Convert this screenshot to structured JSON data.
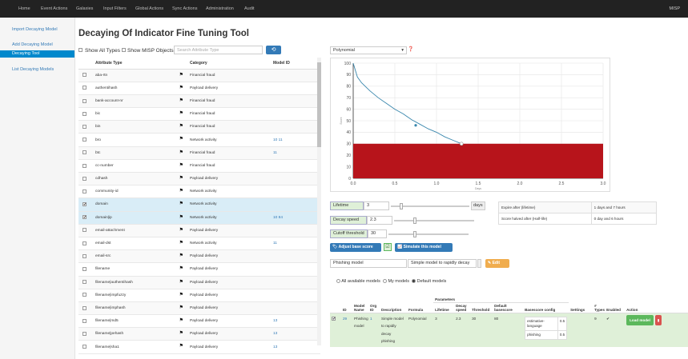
{
  "nav": {
    "items": [
      "Home",
      "Event Actions",
      "Galaxies",
      "Input Filters",
      "Global Actions",
      "Sync Actions",
      "Administration",
      "Audit"
    ],
    "brand": "MISP"
  },
  "sidebar": {
    "items": [
      {
        "label": "Import Decaying Model",
        "active": false
      },
      {
        "label": "Add Decaying Model",
        "active": false
      },
      {
        "label": "Decaying Tool",
        "active": true
      },
      {
        "label": "List Decaying Models",
        "active": false
      }
    ]
  },
  "page_title": "Decaying Of Indicator Fine Tuning Tool",
  "filters": {
    "show_all_types": "Show All Types",
    "show_misp_objects": "Show MISP Objects",
    "search_placeholder": "Search Attribute Type",
    "refresh_icon": "refresh-icon"
  },
  "attr_table": {
    "headers": [
      "",
      "Attribute Type",
      "Category",
      "Model ID"
    ],
    "rows": [
      {
        "type": "aba-rtn",
        "category": "Financial fraud",
        "model_id": "",
        "checked": false
      },
      {
        "type": "authentihash",
        "category": "Payload delivery",
        "model_id": "",
        "checked": false
      },
      {
        "type": "bank-account-nr",
        "category": "Financial fraud",
        "model_id": "",
        "checked": false
      },
      {
        "type": "bic",
        "category": "Financial fraud",
        "model_id": "",
        "checked": false
      },
      {
        "type": "bin",
        "category": "Financial fraud",
        "model_id": "",
        "checked": false
      },
      {
        "type": "bro",
        "category": "Network activity",
        "model_id": "10 11",
        "checked": false
      },
      {
        "type": "btc",
        "category": "Financial fraud",
        "model_id": "11",
        "checked": false
      },
      {
        "type": "cc-number",
        "category": "Financial fraud",
        "model_id": "",
        "checked": false
      },
      {
        "type": "cdhash",
        "category": "Payload delivery",
        "model_id": "",
        "checked": false
      },
      {
        "type": "community-id",
        "category": "Network activity",
        "model_id": "",
        "checked": false
      },
      {
        "type": "domain",
        "category": "Network activity",
        "model_id": "",
        "checked": true
      },
      {
        "type": "domain|ip",
        "category": "Network activity",
        "model_id": "10 84",
        "checked": true
      },
      {
        "type": "email-attachment",
        "category": "Payload delivery",
        "model_id": "",
        "checked": false
      },
      {
        "type": "email-dst",
        "category": "Network activity",
        "model_id": "11",
        "checked": false
      },
      {
        "type": "email-src",
        "category": "Payload delivery",
        "model_id": "",
        "checked": false
      },
      {
        "type": "filename",
        "category": "Payload delivery",
        "model_id": "",
        "checked": false
      },
      {
        "type": "filename|authentihash",
        "category": "Payload delivery",
        "model_id": "",
        "checked": false
      },
      {
        "type": "filename|impfuzzy",
        "category": "Payload delivery",
        "model_id": "",
        "checked": false
      },
      {
        "type": "filename|imphash",
        "category": "Payload delivery",
        "model_id": "",
        "checked": false
      },
      {
        "type": "filename|md5",
        "category": "Payload delivery",
        "model_id": "13",
        "checked": false
      },
      {
        "type": "filename|pehash",
        "category": "Payload delivery",
        "model_id": "13",
        "checked": false
      },
      {
        "type": "filename|sha1",
        "category": "Payload delivery",
        "model_id": "13",
        "checked": false
      }
    ]
  },
  "formula_select": {
    "value": "Polynomial",
    "help_icon": "question-circle-icon"
  },
  "chart_data": {
    "type": "line",
    "xlabel": "Days",
    "ylabel": "Score",
    "xlim": [
      0,
      3
    ],
    "ylim": [
      0,
      100
    ],
    "xticks": [
      "0.0",
      "0.5",
      "1.0",
      "1.5",
      "2.0",
      "2.5",
      "3.0"
    ],
    "yticks": [
      "0",
      "10",
      "20",
      "30",
      "40",
      "50",
      "60",
      "70",
      "80",
      "90",
      "100"
    ],
    "series": [
      {
        "x": [
          0,
          0.05,
          0.1,
          0.2,
          0.3,
          0.4,
          0.5,
          0.6,
          0.7,
          0.8,
          0.9,
          1.0,
          1.1,
          1.2,
          1.3
        ],
        "y": [
          100,
          88,
          83,
          76,
          70,
          65,
          60,
          56,
          51,
          47,
          43,
          40,
          36,
          33,
          30
        ]
      }
    ],
    "markers": [
      {
        "x": 0.75,
        "y": 46
      },
      {
        "x": 1.3,
        "y": 30
      }
    ],
    "threshold_band": {
      "from": 0,
      "to": 30,
      "color": "#b7141b"
    },
    "line_color": "#3a87ad",
    "grid": true
  },
  "controls": {
    "lifetime_label": "Lifetime",
    "lifetime_value": "3",
    "lifetime_unit": "days",
    "lifetime_slider": 0.1,
    "decay_label": "Decay speed",
    "decay_value": "2.3",
    "decay_slider": 0.23,
    "cutoff_label": "Cutoff threshold",
    "cutoff_value": "30",
    "cutoff_slider": 0.3,
    "adjust_btn": "Adjust base score",
    "simulate_btn": "Simulate this model"
  },
  "info": {
    "rows": [
      [
        "Expire after (lifetime)",
        "1 days and 7 hours"
      ],
      [
        "Score halved after (Half-life)",
        "0 day and 6 hours"
      ]
    ]
  },
  "model_form": {
    "name": "Phishing model",
    "description": "Simple model to rapidly decay",
    "edit_btn": "Edit"
  },
  "model_filter": {
    "all": "All available models",
    "mine": "My models",
    "default": "Default models"
  },
  "model_table": {
    "parameters_header": "Parameters",
    "headers": [
      "",
      "ID",
      "Model Name",
      "Org ID",
      "Description",
      "Formula",
      "Lifetime",
      "Decay speed",
      "Threshold",
      "Default basescore",
      "Basescore config",
      "Settings",
      "# Types",
      "Enabled",
      "Action"
    ],
    "row": {
      "id": "29",
      "name": "Phishing model",
      "org_id": "1",
      "description": "Simple model to rapidly decay phishing",
      "formula": "Polynomial",
      "lifetime": "3",
      "decay_speed": "2.3",
      "threshold": "30",
      "default_basescore": "80",
      "basescore_config": [
        [
          "estimative-language",
          "0.5"
        ],
        [
          "phishing",
          "0.5"
        ]
      ],
      "types": "9",
      "enabled": "✔",
      "load_btn": "Load model"
    }
  }
}
